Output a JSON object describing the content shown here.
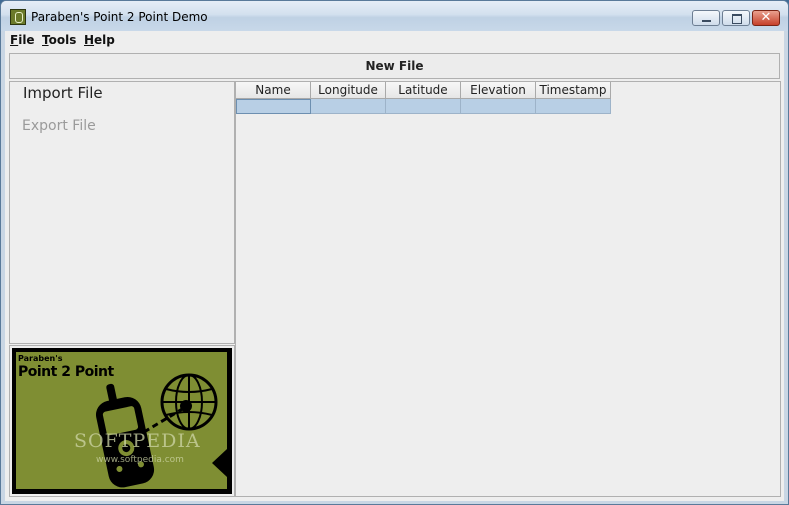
{
  "window": {
    "title": "Paraben's Point 2 Point Demo",
    "close_glyph": "✕"
  },
  "menu": {
    "items": [
      {
        "accel": "F",
        "rest": "ile"
      },
      {
        "accel": "T",
        "rest": "ools"
      },
      {
        "accel": "H",
        "rest": "elp"
      }
    ]
  },
  "toolbar": {
    "new_file_label": "New File"
  },
  "side_panel": {
    "import_label": "Import File",
    "export_label": "Export File",
    "export_enabled": false
  },
  "logo": {
    "subtitle": "Paraben's",
    "title": "Point 2 Point",
    "watermark": "SOFTPEDIA",
    "watermark_url": "www.softpedia.com",
    "background_color": "#7f8e33"
  },
  "table": {
    "columns": [
      "Name",
      "Longitude",
      "Latitude",
      "Elevation",
      "Timestamp"
    ],
    "rows": [
      [
        "",
        "",
        "",
        "",
        ""
      ]
    ],
    "selected_row_color": "#b8cfe5"
  }
}
